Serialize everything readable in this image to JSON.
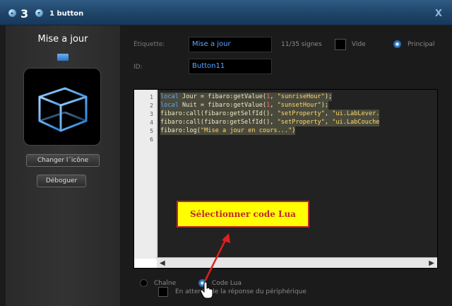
{
  "titlebar": {
    "number": "3",
    "title": "1 button",
    "close_label": "X"
  },
  "sidebar": {
    "button_name": "Mise a jour",
    "change_icon_label": "Changer l´icône",
    "debug_label": "Déboguer"
  },
  "form": {
    "label_label": "Étiquette:",
    "label_value": "Mise a jour",
    "char_count": "11/35 signes",
    "empty_label": "Vide",
    "principal_label": "Principal",
    "id_label": "ID:",
    "id_value": "Button11"
  },
  "code": {
    "line_numbers": [
      "1",
      "2",
      "3",
      "4",
      "5",
      "6"
    ],
    "lines": [
      "local Jour = fibaro:getValue(1, \"sunriseHour\");",
      "local Nuit = fibaro:getValue(1, \"sunsetHour\");",
      "fibaro:call(fibaro:getSelfId(), \"setProperty\", \"ui.LabLever.",
      "fibaro:call(fibaro:getSelfId(), \"setProperty\", \"ui.LabCouche",
      "fibaro:log(\"Mise a jour en cours...\")",
      ""
    ]
  },
  "annotation": {
    "text": "Sélectionner code Lua",
    "color": "#c1272d",
    "background": "#ffff00"
  },
  "bottom": {
    "string_label": "Chaîne",
    "lua_label": "Code Lua",
    "wait_label": "En attente de la réponse du périphérique"
  },
  "icons": {
    "nav_up": "chevron-up-icon",
    "nav_down": "chevron-down-icon",
    "device": "cube-icon",
    "cursor": "hand-pointer-icon"
  },
  "colors": {
    "accent": "#5aa7ff",
    "titlebar": "#1f4468"
  }
}
